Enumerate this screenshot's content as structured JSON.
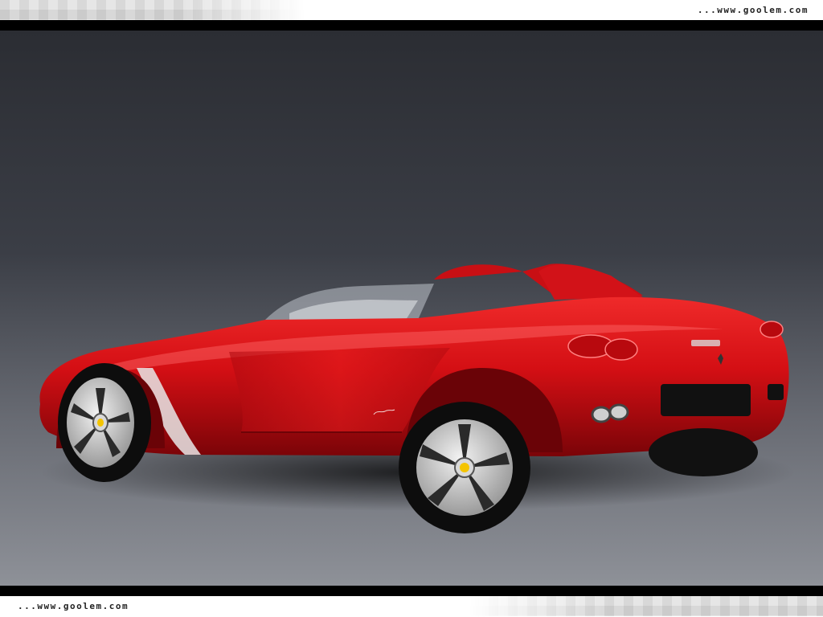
{
  "watermark": {
    "top": "...www.goolem.com",
    "bottom": "...www.goolem.com"
  },
  "colors": {
    "car_body": "#d40f14",
    "background_dark": "#2b2d33",
    "background_light": "#8e9198",
    "band": "#000000"
  },
  "icons": {
    "badge": "prancing-horse-badge-icon"
  }
}
